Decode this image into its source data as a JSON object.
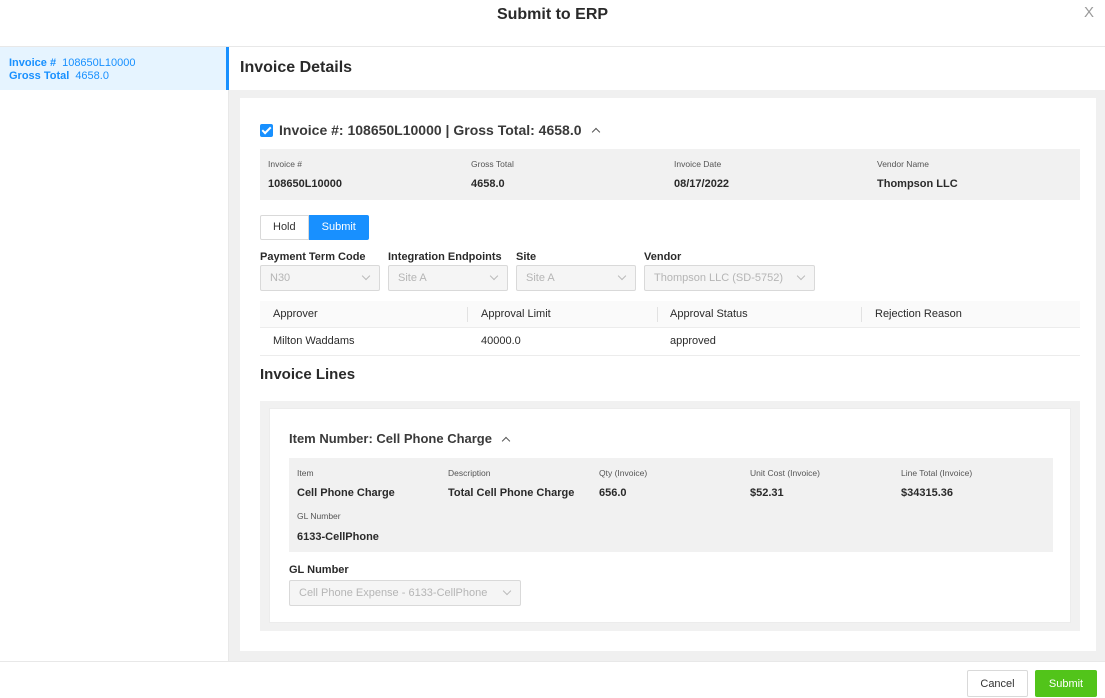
{
  "modal": {
    "title": "Submit to ERP",
    "close_glyph": "X"
  },
  "sidebar": {
    "items": [
      {
        "invoice_label": "Invoice #",
        "invoice_value": "108650L10000",
        "gross_label": "Gross Total",
        "gross_value": "4658.0"
      }
    ]
  },
  "main": {
    "title": "Invoice Details",
    "invoice": {
      "header": "Invoice #: 108650L10000 | Gross Total: 4658.0",
      "checked": true,
      "summary": [
        {
          "label": "Invoice #",
          "value": "108650L10000"
        },
        {
          "label": "Gross Total",
          "value": "4658.0"
        },
        {
          "label": "Invoice Date",
          "value": "08/17/2022"
        },
        {
          "label": "Vendor Name",
          "value": "Thompson LLC"
        }
      ],
      "action_toggle": {
        "hold_label": "Hold",
        "submit_label": "Submit",
        "selected": "Submit"
      },
      "fields": {
        "payment_term_code": {
          "label": "Payment Term Code",
          "value": "N30"
        },
        "integration_endpoints": {
          "label": "Integration Endpoints",
          "value": "Site A"
        },
        "site": {
          "label": "Site",
          "value": "Site A"
        },
        "vendor": {
          "label": "Vendor",
          "value": "Thompson LLC (SD-5752)"
        }
      },
      "approvers": {
        "columns": [
          "Approver",
          "Approval Limit",
          "Approval Status",
          "Rejection Reason"
        ],
        "rows": [
          [
            "Milton Waddams",
            "40000.0",
            "approved",
            ""
          ]
        ]
      }
    },
    "invoice_lines": {
      "title": "Invoice Lines",
      "items": [
        {
          "header": "Item Number: Cell Phone Charge",
          "summary": [
            {
              "label": "Item",
              "value": "Cell Phone Charge"
            },
            {
              "label": "Description",
              "value": "Total Cell Phone Charge"
            },
            {
              "label": "Qty (Invoice)",
              "value": "656.0"
            },
            {
              "label": "Unit Cost (Invoice)",
              "value": "$52.31"
            },
            {
              "label": "Line Total (Invoice)",
              "value": "$34315.36"
            },
            {
              "label": "GL Number",
              "value": "6133-CellPhone"
            }
          ],
          "gl_field": {
            "label": "GL Number",
            "value": "Cell Phone Expense - 6133-CellPhone"
          }
        }
      ]
    }
  },
  "footer": {
    "cancel_label": "Cancel",
    "submit_label": "Submit"
  },
  "colors": {
    "primary": "#1890ff",
    "success": "#52c41a",
    "selected_bg": "#e6f4ff"
  }
}
